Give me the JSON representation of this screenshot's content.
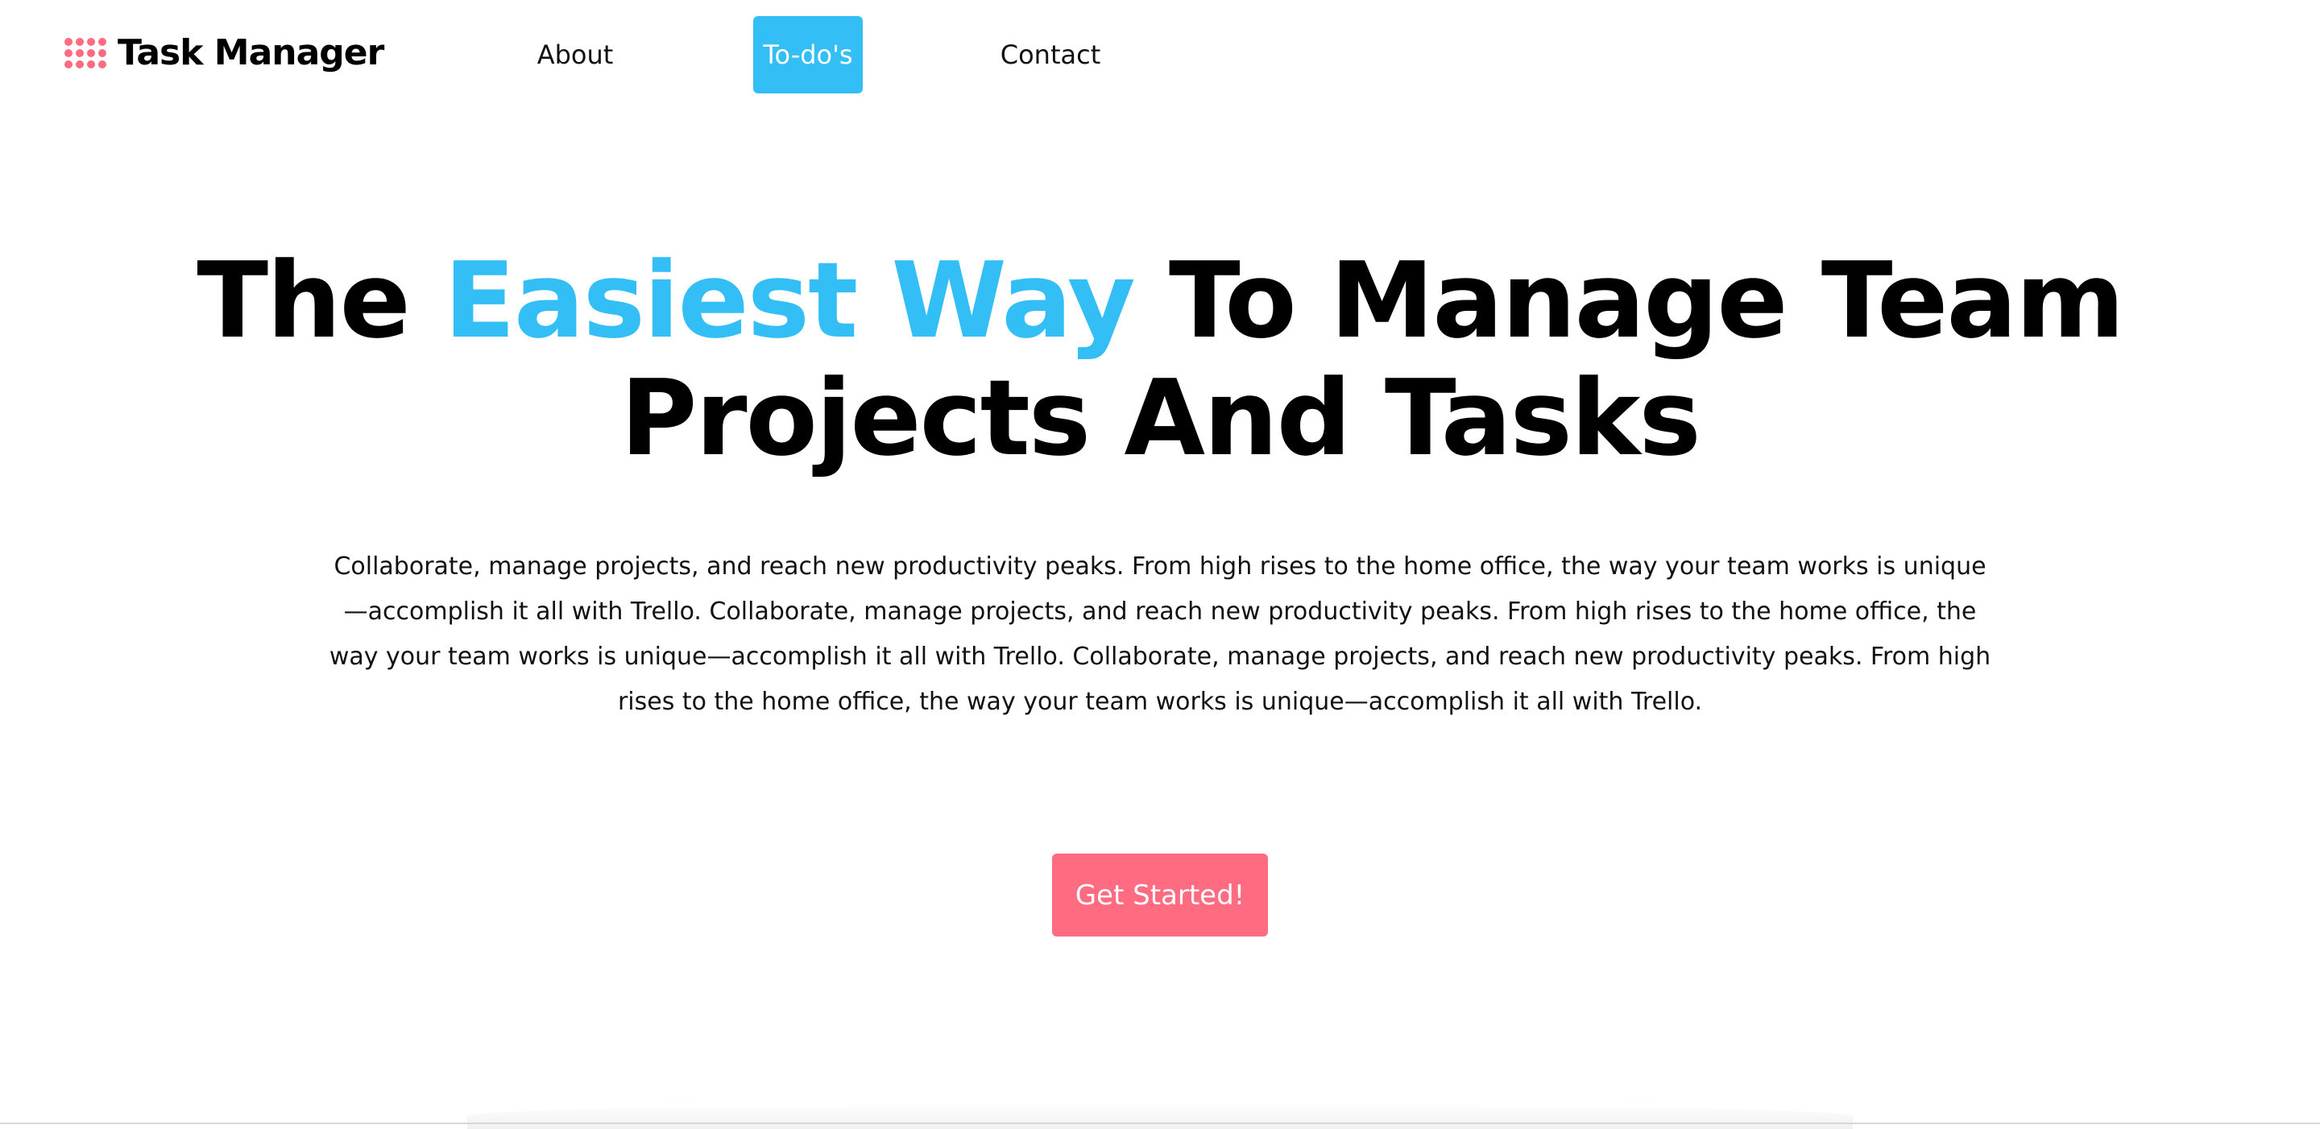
{
  "brand": {
    "name": "Task Manager",
    "icon": "grid-dots-icon",
    "icon_color": "#ff6b81"
  },
  "nav": {
    "items": [
      {
        "label": "About",
        "active": false
      },
      {
        "label": "To-do's",
        "active": true
      },
      {
        "label": "Contact",
        "active": false
      }
    ],
    "active_color": "#33bff5"
  },
  "hero": {
    "title_part1": "The ",
    "title_accent": "Easiest Way",
    "title_part2": " To Manage Team Projects And Tasks",
    "accent_color": "#33bff5",
    "description": "Collaborate, manage projects, and reach new productivity peaks. From high rises to the home office, the way your team works is unique—accomplish it all with Trello. Collaborate, manage projects, and reach new productivity peaks. From high rises to the home office, the way your team works is unique—accomplish it all with Trello. Collaborate, manage projects, and reach new productivity peaks. From high rises to the home office, the way your team works is unique—accomplish it all with Trello.",
    "cta_label": "Get Started!",
    "cta_color": "#ff6b81"
  }
}
